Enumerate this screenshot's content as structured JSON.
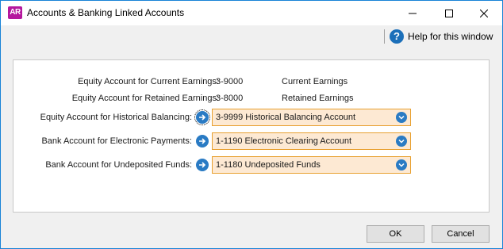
{
  "window": {
    "app_icon_text": "AR",
    "title": "Accounts & Banking Linked Accounts"
  },
  "toolbar": {
    "help_label": "Help for this window",
    "help_icon_glyph": "?"
  },
  "static_rows": [
    {
      "label": "Equity Account for Current Earnings:",
      "account_number": "3-9000",
      "account_name": "Current Earnings"
    },
    {
      "label": "Equity Account for Retained Earnings:",
      "account_number": "3-8000",
      "account_name": "Retained Earnings"
    }
  ],
  "linked_rows": [
    {
      "label": "Equity Account for Historical Balancing:",
      "value": "3-9999 Historical Balancing Account",
      "focused": true
    },
    {
      "label": "Bank Account for Electronic Payments:",
      "value": "1-1190 Electronic Clearing Account",
      "focused": false
    },
    {
      "label": "Bank Account for Undeposited Funds:",
      "value": "1-1180 Undeposited Funds",
      "focused": false
    }
  ],
  "buttons": {
    "ok_label": "OK",
    "cancel_label": "Cancel"
  },
  "colors": {
    "combo_bg": "#fde9d3",
    "combo_border": "#e8a030",
    "accent_blue": "#2a7bc4",
    "app_icon": "#b5179e"
  }
}
